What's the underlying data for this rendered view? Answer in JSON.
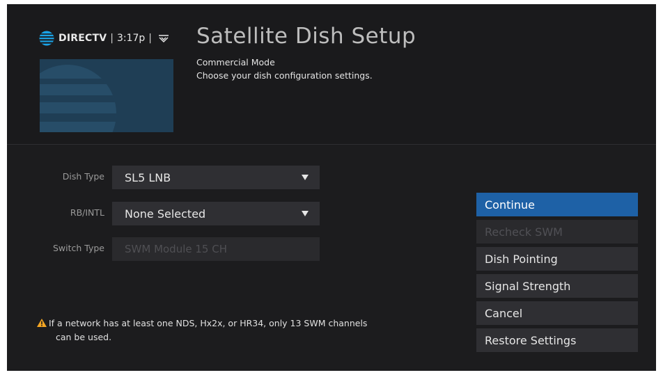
{
  "header": {
    "brand": "DIRECTV",
    "separator": "|",
    "time": "3:17p",
    "title": "Satellite Dish Setup",
    "subtitle": "Commercial Mode",
    "instruction": "Choose your dish configuration settings."
  },
  "form": {
    "dish_type": {
      "label": "Dish Type",
      "value": "SL5 LNB"
    },
    "rb_intl": {
      "label": "RB/INTL",
      "value": "None Selected"
    },
    "switch_type": {
      "label": "Switch Type",
      "value": "SWM Module 15 CH"
    }
  },
  "menu": {
    "continue": "Continue",
    "recheck_swm": "Recheck SWM",
    "dish_pointing": "Dish Pointing",
    "signal_strength": "Signal Strength",
    "cancel": "Cancel",
    "restore_settings": "Restore Settings"
  },
  "warning": {
    "line1": "If a network has at least one NDS, Hx2x, or HR34, only 13 SWM channels",
    "line2": "can be used."
  },
  "colors": {
    "background": "#1c1c1e",
    "selected": "#1e61a6",
    "field": "#2f2f33",
    "brand_blue": "#1aa4e8",
    "warning": "#f5a623"
  },
  "icons": {
    "brand": "att-globe-icon",
    "network": "wifi-icon",
    "dropdown": "caret-down-icon",
    "alert": "warning-icon"
  }
}
